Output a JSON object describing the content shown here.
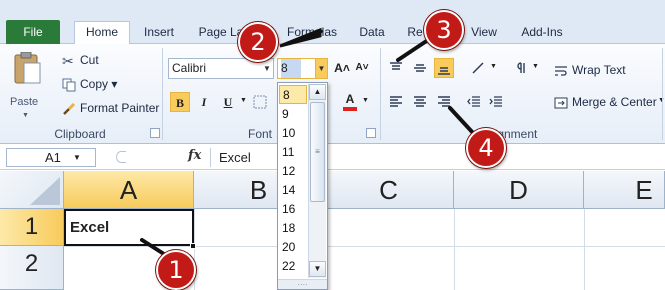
{
  "tabs": {
    "file": "File",
    "items": [
      "Home",
      "Insert",
      "Page La",
      "Formulas",
      "Data",
      "Re",
      "View",
      "Add-Ins"
    ]
  },
  "clipboard": {
    "paste": "Paste",
    "cut": "Cut",
    "copy": "Copy ▾",
    "format_painter": "Format Painter",
    "group_label": "Clipboard"
  },
  "font": {
    "name": "Calibri",
    "size": "8",
    "bold": "B",
    "italic": "I",
    "underline": "U",
    "grow": "A˄",
    "shrink": "A˅",
    "color_letter": "A",
    "group_label": "Font"
  },
  "alignment": {
    "wrap_text": "Wrap Text",
    "merge_center": "Merge & Center",
    "group_label": "lignment"
  },
  "formula_bar": {
    "name_box": "A1",
    "fx": "fx",
    "content": "Excel"
  },
  "grid": {
    "columns": [
      "A",
      "B",
      "C",
      "D",
      "E"
    ],
    "rows": [
      "1",
      "2"
    ],
    "a1_value": "Excel"
  },
  "font_size_list": [
    "8",
    "9",
    "10",
    "11",
    "12",
    "14",
    "16",
    "18",
    "20",
    "22"
  ],
  "callouts": [
    "1",
    "2",
    "3",
    "4"
  ],
  "colors": {
    "file_tab": "#2a7a39",
    "highlight": "#f8cb5c",
    "callout": "#c21b17",
    "font_color_bar": "#e0201c"
  }
}
